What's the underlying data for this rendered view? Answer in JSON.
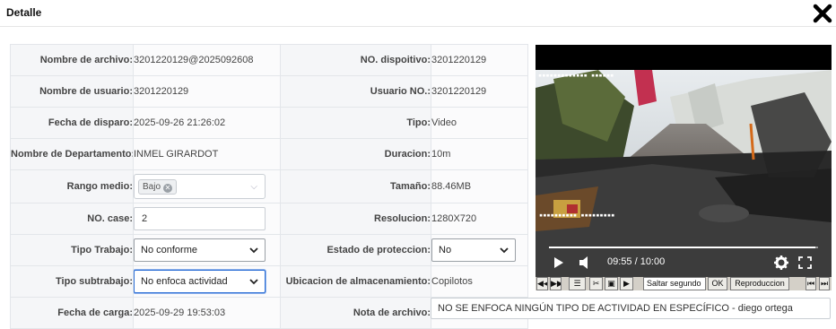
{
  "dialog": {
    "title": "Detalle",
    "close_icon": "close-x-icon"
  },
  "fields": {
    "nombre_archivo": {
      "label": "Nombre de archivo:",
      "value": "3201220129@2025092608"
    },
    "no_dispositivo": {
      "label": "NO. dispoitivo:",
      "value": "3201220129"
    },
    "nombre_usuario": {
      "label": "Nombre de usuario:",
      "value": "3201220129"
    },
    "usuario_no": {
      "label": "Usuario NO.:",
      "value": "3201220129"
    },
    "fecha_disparo": {
      "label": "Fecha de disparo:",
      "value": "2025-09-26 21:26:02"
    },
    "tipo": {
      "label": "Tipo:",
      "value": "Video"
    },
    "departamento": {
      "label": "Nombre de Departamento:",
      "value": "INMEL GIRARDOT"
    },
    "duracion": {
      "label": "Duracion:",
      "value": "10m"
    },
    "rango_medio": {
      "label": "Rango medio:",
      "tag": "Bajo"
    },
    "tamano": {
      "label": "Tamaño:",
      "value": "88.46MB"
    },
    "no_case": {
      "label": "NO. case:",
      "value": "2"
    },
    "resolucion": {
      "label": "Resolucion:",
      "value": "1280X720"
    },
    "tipo_trabajo": {
      "label": "Tipo Trabajo:",
      "value": "No conforme"
    },
    "estado_proteccion": {
      "label": "Estado de proteccion:",
      "value": "No"
    },
    "tipo_subtrabajo": {
      "label": "Tipo subtrabajo:",
      "value": "No enfoca actividad"
    },
    "ubicacion": {
      "label": "Ubicacion de almacenamiento:",
      "value": "Copilotos"
    },
    "fecha_carga": {
      "label": "Fecha de carga:",
      "value": "2025-09-29 19:53:03"
    },
    "nota_archivo": {
      "label": "Nota de archivo:",
      "value": "NO SE ENFOCA NINGÚN TIPO DE ACTIVIDAD EN ESPECÍFICO - diego ortega"
    }
  },
  "player": {
    "time_display": "09:55 / 10:00",
    "progress": 0.99,
    "play_icon": "play-icon",
    "volume_icon": "volume-icon",
    "settings_icon": "gear-icon",
    "fullscreen_icon": "fullscreen-icon"
  },
  "toolbar": {
    "saltar_placeholder": "Saltar segundo",
    "ok_label": "OK",
    "reproduccion_label": "Reproduccion"
  },
  "colors": {
    "focus": "#2d6fd6",
    "label_bg": "#f5f6f8",
    "toolbar_bg": "#d4d0c8"
  }
}
